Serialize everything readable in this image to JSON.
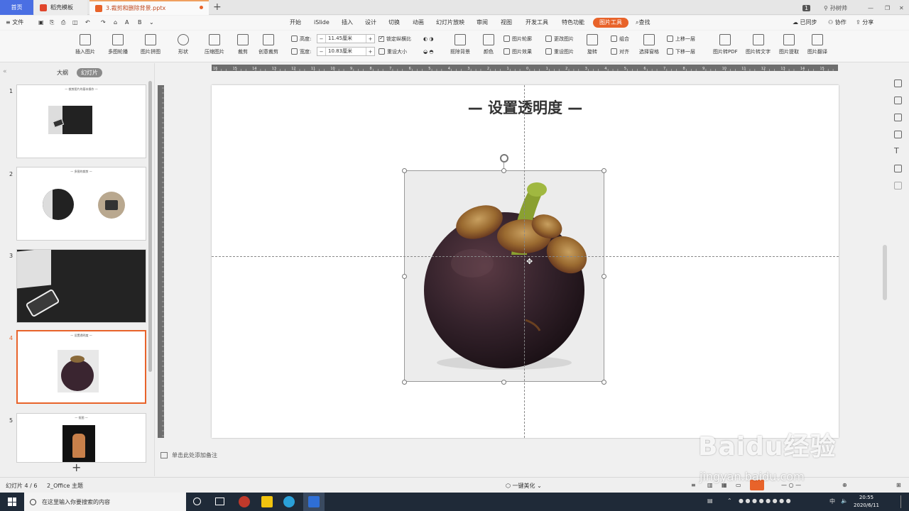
{
  "window": {
    "tabs": [
      {
        "label": "首页"
      },
      {
        "label": "稻壳模板"
      },
      {
        "label": "3.裁剪和删除背景.pptx"
      }
    ],
    "page_badge": "1",
    "user": "孙树帅"
  },
  "menu": {
    "file": "文件",
    "items": [
      "开始",
      "iSlide",
      "插入",
      "设计",
      "切换",
      "动画",
      "幻灯片放映",
      "审阅",
      "视图",
      "开发工具",
      "特色功能",
      "图片工具"
    ],
    "active": "图片工具",
    "search": "查找",
    "sync": "已同步",
    "collab": "协作",
    "share": "分享"
  },
  "ribbon": {
    "insert_picture": "插入图片",
    "multi_crop": "多图轮播",
    "picture_collage": "图片拼图",
    "shape": "形状",
    "compress": "压缩图片",
    "crop": "裁剪",
    "creative_crop": "创意裁剪",
    "height_label": "高度:",
    "height_value": "11.45厘米",
    "width_label": "宽度:",
    "width_value": "10.83厘米",
    "lock_ratio": "锁定纵横比",
    "reset_size": "重设大小",
    "remove_bg": "抠除背景",
    "color": "颜色",
    "picture_outline": "图片轮廓",
    "picture_effect": "图片效果",
    "change_picture": "更改图片",
    "reset_picture": "重设图片",
    "rotate": "旋转",
    "combine": "组合",
    "align": "对齐",
    "selection_pane": "选择窗格",
    "bring_forward": "上移一层",
    "send_backward": "下移一层",
    "to_pdf": "图片转PDF",
    "to_text": "图片转文字",
    "extract": "图片提取",
    "translate": "图片翻译"
  },
  "panel": {
    "outline_tab": "大纲",
    "slides_tab": "幻灯片",
    "slides": [
      {
        "num": "1",
        "title": "— 裁剪图片的基本操作 —"
      },
      {
        "num": "2",
        "title": "— 多图的裁剪 —"
      },
      {
        "num": "3",
        "title": ""
      },
      {
        "num": "4",
        "title": "— 设置透明度 —"
      },
      {
        "num": "5",
        "title": "— 抠图 —"
      }
    ]
  },
  "slide": {
    "title": "— 设置透明度 —"
  },
  "ruler": {
    "h_ticks": [
      "16",
      "15",
      "14",
      "13",
      "12",
      "11",
      "10",
      "9",
      "8",
      "7",
      "6",
      "5",
      "4",
      "3",
      "2",
      "1",
      "0",
      "1",
      "2",
      "3",
      "4",
      "5",
      "6",
      "7",
      "8",
      "9",
      "10",
      "11",
      "12",
      "13",
      "14",
      "15",
      "16"
    ]
  },
  "notes": {
    "placeholder": "单击此处添加备注"
  },
  "status": {
    "slide_counter": "幻灯片 4 / 6",
    "theme": "2_Office 主题",
    "beautify": "一键美化"
  },
  "taskbar": {
    "search_placeholder": "在这里输入你要搜索的内容",
    "time": "20:55",
    "date": "2020/6/11"
  },
  "watermark": {
    "main": "Baidu经验",
    "sub": "jingyan.baidu.com"
  },
  "colors": {
    "accent": "#e8632a",
    "home_tab": "#4a6fe3",
    "taskbar": "#1f2a38"
  }
}
